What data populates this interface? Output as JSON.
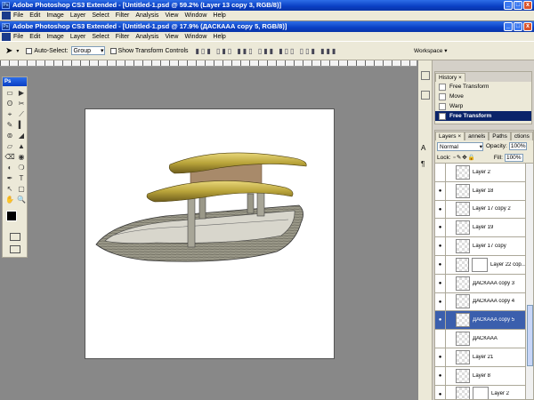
{
  "outer_title": "Adobe Photoshop CS3 Extended - [Untitled-1.psd @ 59.2% (Layer 13 copy 3, RGB/8)]",
  "inner_title": "Adobe Photoshop CS3 Extended - [Untitled-1.psd @ 17.9% (ДАСКААА copy 5, RGB/8)]",
  "menu": [
    "File",
    "Edit",
    "Image",
    "Layer",
    "Select",
    "Filter",
    "Analysis",
    "View",
    "Window",
    "Help"
  ],
  "window_buttons": [
    "_",
    "□",
    "x"
  ],
  "options": {
    "auto_select_label": "Auto-Select:",
    "auto_select_value": "Group",
    "transform_label": "Show Transform Controls",
    "workspace_label": "Workspace ▾"
  },
  "toolbox": {
    "title": "Ps",
    "tools": [
      "▭",
      "▶",
      "ʘ",
      "✂",
      "⌖",
      "⟋",
      "✎",
      "▍",
      "⊚",
      "◢",
      "▱",
      "▲",
      "⌫",
      "◉",
      "◐",
      "❍",
      "✒",
      "T",
      "↖",
      "▢",
      "✋",
      "🔍"
    ]
  },
  "history": {
    "tab": "History ×",
    "items": [
      {
        "label": "Free Transform",
        "selected": false
      },
      {
        "label": "Move",
        "selected": false
      },
      {
        "label": "Warp",
        "selected": false
      },
      {
        "label": "Free Transform",
        "selected": true
      }
    ]
  },
  "layers_panel": {
    "tabs": [
      "Layers ×",
      "annels",
      "Paths",
      "ctions"
    ],
    "blend_mode": "Normal",
    "opacity_label": "Opacity:",
    "opacity_value": "100%",
    "lock_label": "Lock:",
    "fill_label": "Fill:",
    "fill_value": "100%",
    "layers": [
      {
        "name": "Layer 2",
        "visible": false,
        "selected": false,
        "mask": false
      },
      {
        "name": "Layer 18",
        "visible": true,
        "selected": false,
        "mask": false
      },
      {
        "name": "Layer 17 copy 2",
        "visible": true,
        "selected": false,
        "mask": false
      },
      {
        "name": "Layer 19",
        "visible": true,
        "selected": false,
        "mask": false
      },
      {
        "name": "Layer 17 copy",
        "visible": true,
        "selected": false,
        "mask": false
      },
      {
        "name": "Layer 22 cop...",
        "visible": true,
        "selected": false,
        "mask": true
      },
      {
        "name": "ДАСКААА copy 3",
        "visible": true,
        "selected": false,
        "mask": false
      },
      {
        "name": "ДАСКААА copy 4",
        "visible": true,
        "selected": false,
        "mask": false
      },
      {
        "name": "ДАСКААА copy 5",
        "visible": true,
        "selected": true,
        "mask": false
      },
      {
        "name": "ДАСКААА",
        "visible": false,
        "selected": false,
        "mask": false
      },
      {
        "name": "Layer 21",
        "visible": true,
        "selected": false,
        "mask": false
      },
      {
        "name": "Layer 8",
        "visible": true,
        "selected": false,
        "mask": false
      },
      {
        "name": "Layer 2",
        "visible": true,
        "selected": false,
        "mask": true
      }
    ]
  },
  "colors": {
    "title_blue": "#0a3fc4",
    "selected_layer": "#3b5fad",
    "chrome": "#ece9d8",
    "workspace_gray": "#888888"
  }
}
